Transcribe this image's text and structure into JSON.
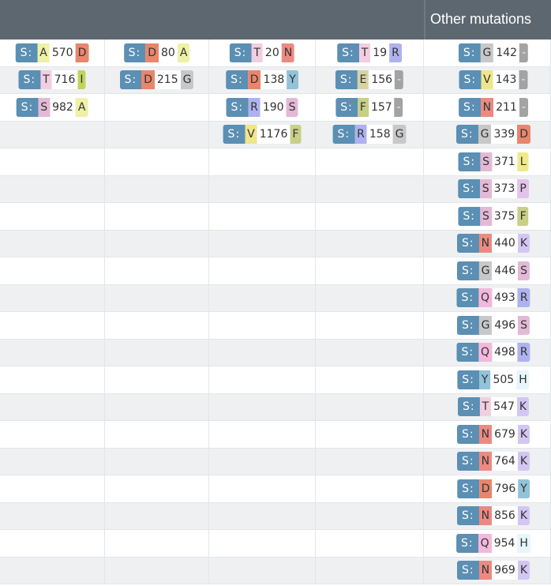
{
  "header": {
    "other_title": "Other mutations"
  },
  "colors": {
    "A": "#eef1a6",
    "D": "#e8866c",
    "T": "#f2cfe0",
    "I": "#c4d25a",
    "S": "#e3b9d6",
    "V": "#f0e58a",
    "R": "#aeb2ee",
    "Y": "#92c3d8",
    "E": "#d8d3a6",
    "F": "#c8cf86",
    "N": "#ec8a82",
    "G": "#c8c8c8",
    "-": "#a3a3a3",
    "L": "#efe98a",
    "P": "#e3c3ec",
    "K": "#d3c6f4",
    "Q": "#f3b8dc",
    "H": "#e6f6fb",
    "gene": "#5b8fb3"
  },
  "grid_left": [
    [
      {
        "gene": "S:",
        "ref": "A",
        "pos": "570",
        "alt": "D"
      },
      {
        "gene": "S:",
        "ref": "D",
        "pos": "80",
        "alt": "A"
      },
      {
        "gene": "S:",
        "ref": "T",
        "pos": "20",
        "alt": "N"
      },
      {
        "gene": "S:",
        "ref": "T",
        "pos": "19",
        "alt": "R"
      }
    ],
    [
      {
        "gene": "S:",
        "ref": "T",
        "pos": "716",
        "alt": "I"
      },
      {
        "gene": "S:",
        "ref": "D",
        "pos": "215",
        "alt": "G"
      },
      {
        "gene": "S:",
        "ref": "D",
        "pos": "138",
        "alt": "Y"
      },
      {
        "gene": "S:",
        "ref": "E",
        "pos": "156",
        "alt": "-"
      }
    ],
    [
      {
        "gene": "S:",
        "ref": "S",
        "pos": "982",
        "alt": "A"
      },
      null,
      {
        "gene": "S:",
        "ref": "R",
        "pos": "190",
        "alt": "S"
      },
      {
        "gene": "S:",
        "ref": "F",
        "pos": "157",
        "alt": "-"
      }
    ],
    [
      null,
      null,
      {
        "gene": "S:",
        "ref": "V",
        "pos": "1176",
        "alt": "F"
      },
      {
        "gene": "S:",
        "ref": "R",
        "pos": "158",
        "alt": "G"
      }
    ]
  ],
  "grid_left_total_rows": 20,
  "other_mutations": [
    {
      "gene": "S:",
      "ref": "G",
      "pos": "142",
      "alt": "-"
    },
    {
      "gene": "S:",
      "ref": "V",
      "pos": "143",
      "alt": "-"
    },
    {
      "gene": "S:",
      "ref": "N",
      "pos": "211",
      "alt": "-"
    },
    {
      "gene": "S:",
      "ref": "G",
      "pos": "339",
      "alt": "D"
    },
    {
      "gene": "S:",
      "ref": "S",
      "pos": "371",
      "alt": "L"
    },
    {
      "gene": "S:",
      "ref": "S",
      "pos": "373",
      "alt": "P"
    },
    {
      "gene": "S:",
      "ref": "S",
      "pos": "375",
      "alt": "F"
    },
    {
      "gene": "S:",
      "ref": "N",
      "pos": "440",
      "alt": "K"
    },
    {
      "gene": "S:",
      "ref": "G",
      "pos": "446",
      "alt": "S"
    },
    {
      "gene": "S:",
      "ref": "Q",
      "pos": "493",
      "alt": "R"
    },
    {
      "gene": "S:",
      "ref": "G",
      "pos": "496",
      "alt": "S"
    },
    {
      "gene": "S:",
      "ref": "Q",
      "pos": "498",
      "alt": "R"
    },
    {
      "gene": "S:",
      "ref": "Y",
      "pos": "505",
      "alt": "H"
    },
    {
      "gene": "S:",
      "ref": "T",
      "pos": "547",
      "alt": "K"
    },
    {
      "gene": "S:",
      "ref": "N",
      "pos": "679",
      "alt": "K"
    },
    {
      "gene": "S:",
      "ref": "N",
      "pos": "764",
      "alt": "K"
    },
    {
      "gene": "S:",
      "ref": "D",
      "pos": "796",
      "alt": "Y"
    },
    {
      "gene": "S:",
      "ref": "N",
      "pos": "856",
      "alt": "K"
    },
    {
      "gene": "S:",
      "ref": "Q",
      "pos": "954",
      "alt": "H"
    },
    {
      "gene": "S:",
      "ref": "N",
      "pos": "969",
      "alt": "K"
    }
  ]
}
